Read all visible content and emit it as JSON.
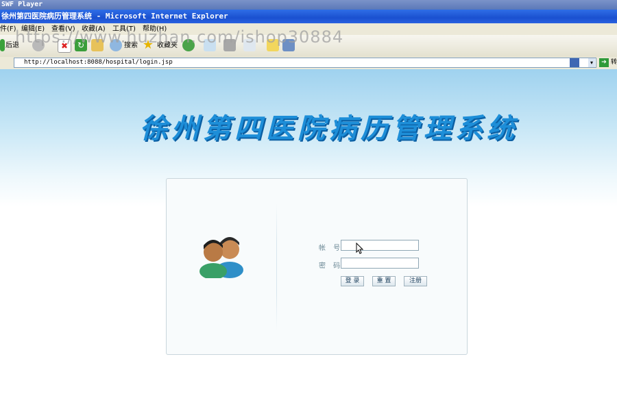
{
  "window": {
    "swf_title": "SWF Player",
    "title": "徐州第四医院病历管理系统 - Microsoft Internet Explorer"
  },
  "menu": {
    "items": [
      "件(F)",
      "编辑(E)",
      "查看(V)",
      "收藏(A)",
      "工具(T)",
      "帮助(H)"
    ]
  },
  "toolbar": {
    "back_label": "后退",
    "search_label": "搜索",
    "favorites_label": "收藏夹"
  },
  "address": {
    "url": "http://localhost:8088/hospital/login.jsp",
    "go_label": "转"
  },
  "watermark": "https://www.huzhan.com/ishop30884",
  "page": {
    "title": "徐州第四医院病历管理系统",
    "login": {
      "account_label": "帐 号",
      "password_label": "密 码",
      "account_value": "",
      "password_value": "",
      "login_button": "登 录",
      "reset_button": "重 置",
      "register_button": "注册"
    }
  },
  "colors": {
    "title_blue": "#1d8ed8",
    "ie_titlebar": "#1a50d0",
    "chrome": "#ece9d8"
  }
}
